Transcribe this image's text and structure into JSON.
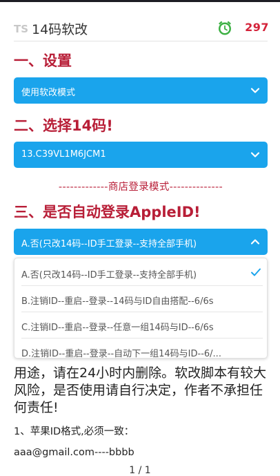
{
  "header": {
    "app_title": "14码软改",
    "counter": "297",
    "icons": {
      "logo": "ts-logo-icon",
      "timer": "alarm-clock-icon"
    }
  },
  "sections": {
    "setup_heading": "一、设置",
    "setup_select": "使用软改模式",
    "code_heading": "二、选择14码!",
    "code_select": "13.C39VL1M6JCM1",
    "store_login_note": "-------------商店登录模式--------------",
    "login_heading": "三、是否自动登录AppleID!",
    "login_select": "A.否(只改14码--ID手工登录--支持全部手机)"
  },
  "dropdown": {
    "options": [
      {
        "label": "A.否(只改14码--ID手工登录--支持全部手机)",
        "selected": true
      },
      {
        "label": "B.注销ID--重启--登录--14码与ID自由搭配--6/6s",
        "selected": false
      },
      {
        "label": "C.注销ID--重启--登录--任意一组14码与ID--6/6s",
        "selected": false
      },
      {
        "label": "D.注销ID--重启--登录--自动下一组14码与ID--6/...",
        "selected": false
      }
    ]
  },
  "content": {
    "disclaimer": "用途，请在24小时内删除。软改脚本有较大风险，是否使用请自行决定，作者不承担任何责任!",
    "rule_1": "1、苹果ID格式,必须一致：",
    "email_example": "aaa@gmail.com----bbbb",
    "page_indicator": "1 / 1"
  },
  "colors": {
    "accent_blue": "#1aa4ec",
    "heading_red": "#b81e37",
    "counter_red": "#d4233a",
    "timer_green": "#3cb043"
  }
}
